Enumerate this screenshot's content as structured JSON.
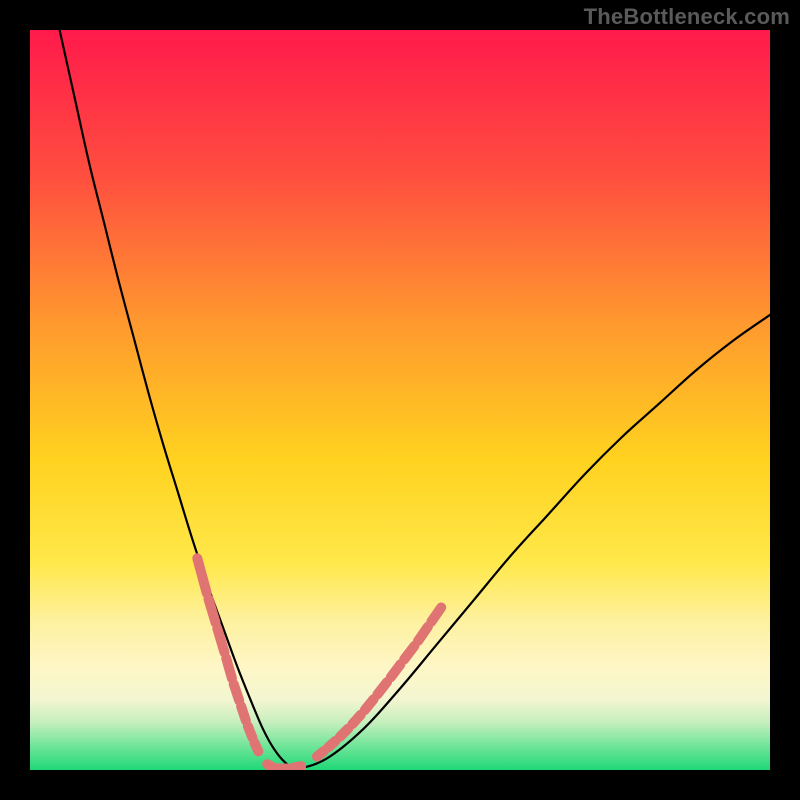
{
  "watermark": "TheBottleneck.com",
  "chart_data": {
    "type": "line",
    "title": "",
    "xlabel": "",
    "ylabel": "",
    "xlim": [
      0,
      100
    ],
    "ylim": [
      0,
      100
    ],
    "grid": false,
    "background_gradient": {
      "stops": [
        {
          "offset": 0.0,
          "color": "#ff1a4b"
        },
        {
          "offset": 0.2,
          "color": "#ff4f3f"
        },
        {
          "offset": 0.4,
          "color": "#ff9a2e"
        },
        {
          "offset": 0.58,
          "color": "#ffd21f"
        },
        {
          "offset": 0.72,
          "color": "#ffe84a"
        },
        {
          "offset": 0.8,
          "color": "#fef1a0"
        },
        {
          "offset": 0.86,
          "color": "#fef6c6"
        },
        {
          "offset": 0.905,
          "color": "#f3f6d0"
        },
        {
          "offset": 0.935,
          "color": "#c7efbe"
        },
        {
          "offset": 0.965,
          "color": "#77e69c"
        },
        {
          "offset": 1.0,
          "color": "#1fd877"
        }
      ]
    },
    "series": [
      {
        "name": "bottleneck-curve",
        "color": "#000000",
        "stroke_width": 2.2,
        "x": [
          4,
          6,
          8,
          10,
          12,
          14,
          16,
          18,
          20,
          22,
          24,
          26,
          28,
          30,
          31.5,
          33,
          34.5,
          36,
          40,
          45,
          50,
          55,
          60,
          65,
          70,
          75,
          80,
          85,
          90,
          95,
          100
        ],
        "values": [
          100,
          91,
          82,
          74,
          66,
          58.5,
          51,
          44,
          37.5,
          31,
          25,
          19.5,
          14,
          9,
          5.5,
          2.8,
          1.0,
          0.2,
          1.5,
          5.5,
          11,
          17,
          23,
          29,
          34.5,
          40,
          45,
          49.5,
          54,
          58,
          61.5
        ]
      },
      {
        "name": "marker-band-left",
        "color": "#e07472",
        "stroke_width": 10,
        "segmented": true,
        "x": [
          22.5,
          24.0,
          25.2,
          26.4,
          27.4,
          28.4,
          29.3,
          30.2,
          31.0
        ],
        "values": [
          29.0,
          23.5,
          19.5,
          15.5,
          12.0,
          9.0,
          6.3,
          4.0,
          2.2
        ]
      },
      {
        "name": "marker-band-bottom",
        "color": "#e07472",
        "stroke_width": 10,
        "segmented": true,
        "x": [
          31.8,
          33.2,
          35.0,
          37.0
        ],
        "values": [
          0.9,
          0.2,
          0.2,
          0.6
        ]
      },
      {
        "name": "marker-band-right",
        "color": "#e07472",
        "stroke_width": 10,
        "segmented": true,
        "x": [
          38.5,
          40.0,
          41.6,
          43.3,
          45.0,
          46.7,
          48.5,
          50.3,
          52.2,
          54.0,
          55.8
        ],
        "values": [
          1.6,
          2.8,
          4.2,
          5.9,
          7.8,
          9.9,
          12.2,
          14.6,
          17.1,
          19.7,
          22.3
        ]
      }
    ]
  }
}
